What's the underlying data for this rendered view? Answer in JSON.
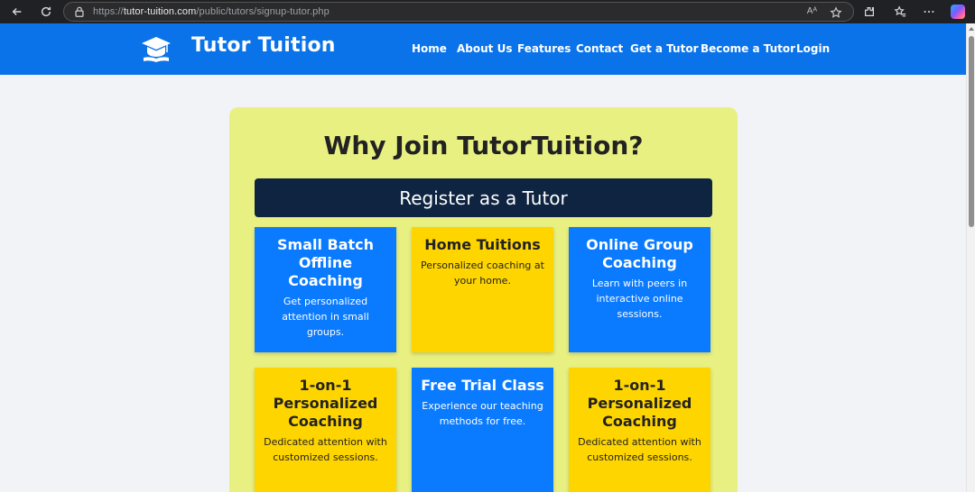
{
  "browser": {
    "url_prefix": "https://",
    "url_domain": "tutor-tuition.com",
    "url_path": "/public/tutors/signup-tutor.php",
    "read_aloud_label": "Aᴬ"
  },
  "site": {
    "brand": "Tutor Tuition",
    "nav": [
      "Home",
      "About Us",
      "Features",
      "Contact",
      "Get a Tutor",
      "Become a Tutor",
      "Login"
    ]
  },
  "section": {
    "title": "Why Join TutorTuition?",
    "register_label": "Register as a Tutor"
  },
  "cards": [
    {
      "title": "Small Batch Offline Coaching",
      "text": "Get personalized attention in small groups.",
      "color": "#0a7aff"
    },
    {
      "title": "Home Tuitions",
      "text": "Personalized coaching at your home.",
      "color": "#ffd500"
    },
    {
      "title": "Online Group Coaching",
      "text": "Learn with peers in interactive online sessions.",
      "color": "#0a7aff"
    },
    {
      "title": "1-on-1 Personalized Coaching",
      "text": "Dedicated attention with customized sessions.",
      "color": "#ffd500"
    },
    {
      "title": "Free Trial Class",
      "text": "Experience our teaching methods for free.",
      "color": "#0a7aff"
    },
    {
      "title": "1-on-1 Personalized Coaching",
      "text": "Dedicated attention with customized sessions.",
      "color": "#ffd500"
    }
  ],
  "colors": {
    "header_blue": "#0a73ea",
    "panel_yellow": "#e8f082",
    "register_navy": "#0e2440"
  }
}
